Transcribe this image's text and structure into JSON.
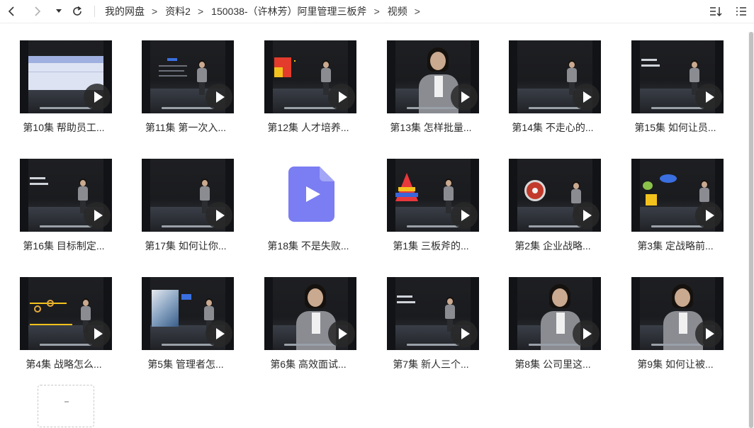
{
  "breadcrumb": [
    "我的网盘",
    "资料2",
    "150038-（许林芳）阿里管理三板斧",
    "视频"
  ],
  "breadcrumb_separator": ">",
  "icons": {
    "back": "chevron-left-icon",
    "forward": "chevron-right-icon",
    "dropdown": "caret-down-icon",
    "refresh": "refresh-icon",
    "sort": "sort-icon",
    "list_view": "list-view-icon",
    "play": "play-icon",
    "video_file": "video-file-icon"
  },
  "colors": {
    "file_icon": "#7b7df2",
    "thumbnail_bg": "#121316",
    "label": "#2e2e2e"
  },
  "files": [
    {
      "label": "第10集 帮助员工...",
      "thumb": "slide-table"
    },
    {
      "label": "第11集 第一次入...",
      "thumb": "slide-text"
    },
    {
      "label": "第12集 人才培养...",
      "thumb": "slide-chart"
    },
    {
      "label": "第13集 怎样批量...",
      "thumb": "closeup"
    },
    {
      "label": "第14集 不走心的...",
      "thumb": "stage"
    },
    {
      "label": "第15集 如何让员...",
      "thumb": "slide-text2"
    },
    {
      "label": "第16集 目标制定...",
      "thumb": "slide-text2"
    },
    {
      "label": "第17集 如何让你...",
      "thumb": "stage"
    },
    {
      "label": "第18集 不是失败...",
      "thumb": "file-icon"
    },
    {
      "label": "第1集 三板斧的...",
      "thumb": "slide-pyramid"
    },
    {
      "label": "第2集 企业战略...",
      "thumb": "slide-target"
    },
    {
      "label": "第3集 定战略前...",
      "thumb": "slide-cartoon"
    },
    {
      "label": "第4集 战略怎么...",
      "thumb": "slide-timeline"
    },
    {
      "label": "第5集 管理者怎...",
      "thumb": "slide-photo"
    },
    {
      "label": "第6集 高效面试...",
      "thumb": "closeup"
    },
    {
      "label": "第7集 新人三个...",
      "thumb": "slide-text2"
    },
    {
      "label": "第8集 公司里这...",
      "thumb": "closeup"
    },
    {
      "label": "第9集 如何让被...",
      "thumb": "closeup"
    }
  ]
}
